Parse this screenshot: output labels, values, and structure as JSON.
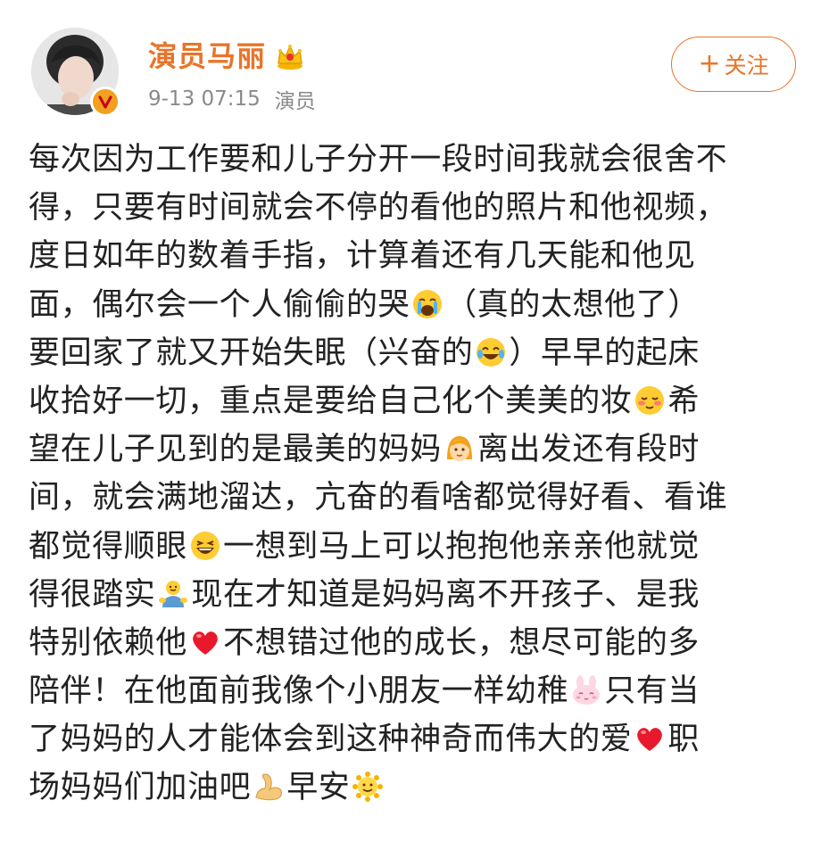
{
  "post": {
    "author": {
      "name": "演员马丽",
      "verified_badge_symbol": "V",
      "badge_color": "#f2a01e",
      "name_color": "#e8742a",
      "crown_icon": "crown-icon"
    },
    "meta": {
      "timestamp": "9-13 07:15",
      "source": "演员"
    },
    "follow_button": {
      "plus": "+",
      "label": "关注"
    },
    "lines": [
      [
        "每次因为工作要和儿子分开一段时间我就会很舍不"
      ],
      [
        "得，只要有时间就会不停的看他的照片和他视频，"
      ],
      [
        "度日如年的数着手指，计算着还有几天能和他见"
      ],
      [
        "面，偶尔会一个人偷偷的哭",
        "[crying-face-icon]",
        "（真的太想他了）"
      ],
      [
        "要回家了就又开始失眠（兴奋的",
        "[tears-of-joy-icon]",
        "）早早的起床"
      ],
      [
        "收拾好一切，重点是要给自己化个美美的妆",
        "[blushing-face-icon]",
        "希"
      ],
      [
        "望在儿子见到的是最美的妈妈",
        "[woman-face-icon]",
        "离出发还有段时"
      ],
      [
        "间，就会满地溜达，亢奋的看啥都觉得好看、看谁"
      ],
      [
        "都觉得顺眼",
        "[laughing-face-icon]",
        "一想到马上可以抱抱他亲亲他就觉"
      ],
      [
        "得很踏实",
        "[hug-icon]",
        "现在才知道是妈妈离不开孩子、是我"
      ],
      [
        "特别依赖他",
        "[red-heart-icon]",
        "不想错过他的成长，想尽可能的多"
      ],
      [
        "陪伴！在他面前我像个小朋友一样幼稚",
        "[bunny-face-icon]",
        "只有当"
      ],
      [
        "了妈妈的人才能体会到这种神奇而伟大的爱",
        "[red-heart-icon]",
        "职"
      ],
      [
        "场妈妈们加油吧",
        "[flexed-biceps-icon]",
        "早安",
        "[sun-face-icon]"
      ]
    ],
    "accent_color": "#e8742a"
  }
}
